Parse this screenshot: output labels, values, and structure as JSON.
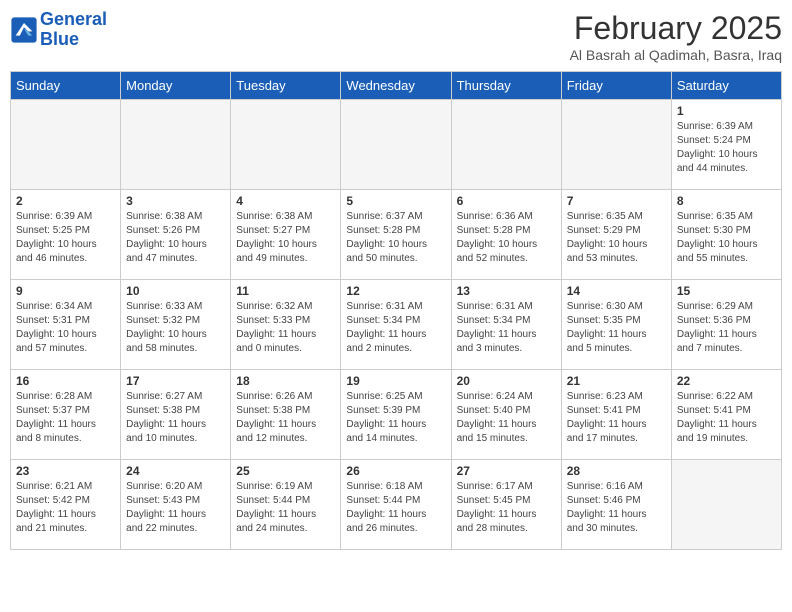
{
  "header": {
    "logo_line1": "General",
    "logo_line2": "Blue",
    "month_title": "February 2025",
    "subtitle": "Al Basrah al Qadimah, Basra, Iraq"
  },
  "weekdays": [
    "Sunday",
    "Monday",
    "Tuesday",
    "Wednesday",
    "Thursday",
    "Friday",
    "Saturday"
  ],
  "weeks": [
    [
      {
        "day": "",
        "info": ""
      },
      {
        "day": "",
        "info": ""
      },
      {
        "day": "",
        "info": ""
      },
      {
        "day": "",
        "info": ""
      },
      {
        "day": "",
        "info": ""
      },
      {
        "day": "",
        "info": ""
      },
      {
        "day": "1",
        "info": "Sunrise: 6:39 AM\nSunset: 5:24 PM\nDaylight: 10 hours and 44 minutes."
      }
    ],
    [
      {
        "day": "2",
        "info": "Sunrise: 6:39 AM\nSunset: 5:25 PM\nDaylight: 10 hours and 46 minutes."
      },
      {
        "day": "3",
        "info": "Sunrise: 6:38 AM\nSunset: 5:26 PM\nDaylight: 10 hours and 47 minutes."
      },
      {
        "day": "4",
        "info": "Sunrise: 6:38 AM\nSunset: 5:27 PM\nDaylight: 10 hours and 49 minutes."
      },
      {
        "day": "5",
        "info": "Sunrise: 6:37 AM\nSunset: 5:28 PM\nDaylight: 10 hours and 50 minutes."
      },
      {
        "day": "6",
        "info": "Sunrise: 6:36 AM\nSunset: 5:28 PM\nDaylight: 10 hours and 52 minutes."
      },
      {
        "day": "7",
        "info": "Sunrise: 6:35 AM\nSunset: 5:29 PM\nDaylight: 10 hours and 53 minutes."
      },
      {
        "day": "8",
        "info": "Sunrise: 6:35 AM\nSunset: 5:30 PM\nDaylight: 10 hours and 55 minutes."
      }
    ],
    [
      {
        "day": "9",
        "info": "Sunrise: 6:34 AM\nSunset: 5:31 PM\nDaylight: 10 hours and 57 minutes."
      },
      {
        "day": "10",
        "info": "Sunrise: 6:33 AM\nSunset: 5:32 PM\nDaylight: 10 hours and 58 minutes."
      },
      {
        "day": "11",
        "info": "Sunrise: 6:32 AM\nSunset: 5:33 PM\nDaylight: 11 hours and 0 minutes."
      },
      {
        "day": "12",
        "info": "Sunrise: 6:31 AM\nSunset: 5:34 PM\nDaylight: 11 hours and 2 minutes."
      },
      {
        "day": "13",
        "info": "Sunrise: 6:31 AM\nSunset: 5:34 PM\nDaylight: 11 hours and 3 minutes."
      },
      {
        "day": "14",
        "info": "Sunrise: 6:30 AM\nSunset: 5:35 PM\nDaylight: 11 hours and 5 minutes."
      },
      {
        "day": "15",
        "info": "Sunrise: 6:29 AM\nSunset: 5:36 PM\nDaylight: 11 hours and 7 minutes."
      }
    ],
    [
      {
        "day": "16",
        "info": "Sunrise: 6:28 AM\nSunset: 5:37 PM\nDaylight: 11 hours and 8 minutes."
      },
      {
        "day": "17",
        "info": "Sunrise: 6:27 AM\nSunset: 5:38 PM\nDaylight: 11 hours and 10 minutes."
      },
      {
        "day": "18",
        "info": "Sunrise: 6:26 AM\nSunset: 5:38 PM\nDaylight: 11 hours and 12 minutes."
      },
      {
        "day": "19",
        "info": "Sunrise: 6:25 AM\nSunset: 5:39 PM\nDaylight: 11 hours and 14 minutes."
      },
      {
        "day": "20",
        "info": "Sunrise: 6:24 AM\nSunset: 5:40 PM\nDaylight: 11 hours and 15 minutes."
      },
      {
        "day": "21",
        "info": "Sunrise: 6:23 AM\nSunset: 5:41 PM\nDaylight: 11 hours and 17 minutes."
      },
      {
        "day": "22",
        "info": "Sunrise: 6:22 AM\nSunset: 5:41 PM\nDaylight: 11 hours and 19 minutes."
      }
    ],
    [
      {
        "day": "23",
        "info": "Sunrise: 6:21 AM\nSunset: 5:42 PM\nDaylight: 11 hours and 21 minutes."
      },
      {
        "day": "24",
        "info": "Sunrise: 6:20 AM\nSunset: 5:43 PM\nDaylight: 11 hours and 22 minutes."
      },
      {
        "day": "25",
        "info": "Sunrise: 6:19 AM\nSunset: 5:44 PM\nDaylight: 11 hours and 24 minutes."
      },
      {
        "day": "26",
        "info": "Sunrise: 6:18 AM\nSunset: 5:44 PM\nDaylight: 11 hours and 26 minutes."
      },
      {
        "day": "27",
        "info": "Sunrise: 6:17 AM\nSunset: 5:45 PM\nDaylight: 11 hours and 28 minutes."
      },
      {
        "day": "28",
        "info": "Sunrise: 6:16 AM\nSunset: 5:46 PM\nDaylight: 11 hours and 30 minutes."
      },
      {
        "day": "",
        "info": ""
      }
    ]
  ]
}
